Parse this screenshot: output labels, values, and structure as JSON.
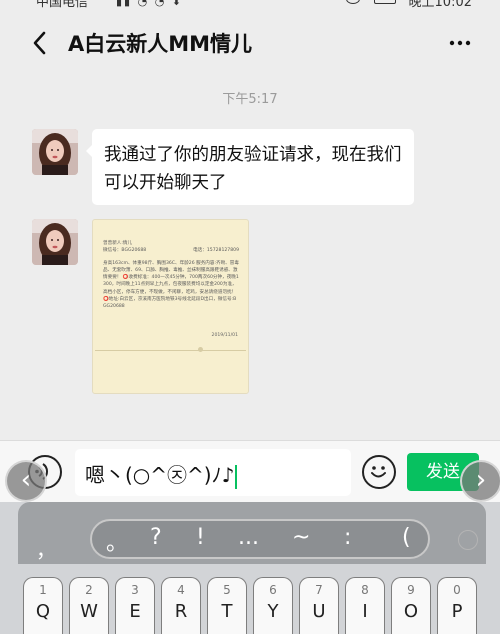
{
  "status_bar": {
    "carrier": "中国电信",
    "time": "晚上10:02"
  },
  "header": {
    "back_icon": "chevron-left-icon",
    "title": "A白云新人MM情儿",
    "more_icon": "more-dots-icon"
  },
  "chat": {
    "timestamp": "下午5:17",
    "messages": [
      {
        "type": "text",
        "text": "我通过了你的朋友验证请求，现在我们可以开始聊天了"
      },
      {
        "type": "image",
        "card_line1": "曾曾新人:情儿",
        "card_wx": "微信号：BGG20688",
        "card_phone": "电话：15728127809",
        "card_body": "身高163cm、体重98斤、胸围36C、年龄26 服务内容:齐吻、冒毒品、无套吹箫、69、口舔、胸推、毒推、丝袜制服高跟鞋诱惑、激情要要！ ⭕收费标准：400一次45分钟，700两次60分钟，夜晚1300，时间晚上11点到早上九点，包夜服装费均以定金200为准，高档小区，停车方便，不现做，不闲聊，吃鸡，安总请绕道勿扰！ ⭕地址:白云区，京溪南方医院地铁3号线北延段D出口，微信号:BGG20688",
        "card_date": "2019/11/01"
      }
    ]
  },
  "input_bar": {
    "voice_icon": "voice-icon",
    "text_value": "嗯丶(○^㉨^)ﾉ♪",
    "emoji_icon": "smiley-icon",
    "send_label": "发送"
  },
  "overlay": {
    "prev_icon": "chevron-left-icon",
    "next_icon": "chevron-right-icon"
  },
  "keyboard": {
    "comma": "，",
    "punctuation": [
      "。",
      "?",
      "!",
      "...",
      "~",
      ":",
      "("
    ],
    "keys": [
      {
        "num": "1",
        "letter": "Q"
      },
      {
        "num": "2",
        "letter": "W"
      },
      {
        "num": "3",
        "letter": "E"
      },
      {
        "num": "4",
        "letter": "R"
      },
      {
        "num": "5",
        "letter": "T"
      },
      {
        "num": "6",
        "letter": "Y"
      },
      {
        "num": "7",
        "letter": "U"
      },
      {
        "num": "8",
        "letter": "I"
      },
      {
        "num": "9",
        "letter": "O"
      },
      {
        "num": "0",
        "letter": "P"
      }
    ]
  },
  "colors": {
    "accent": "#07c160",
    "background": "#ededed",
    "bubble": "#ffffff"
  }
}
